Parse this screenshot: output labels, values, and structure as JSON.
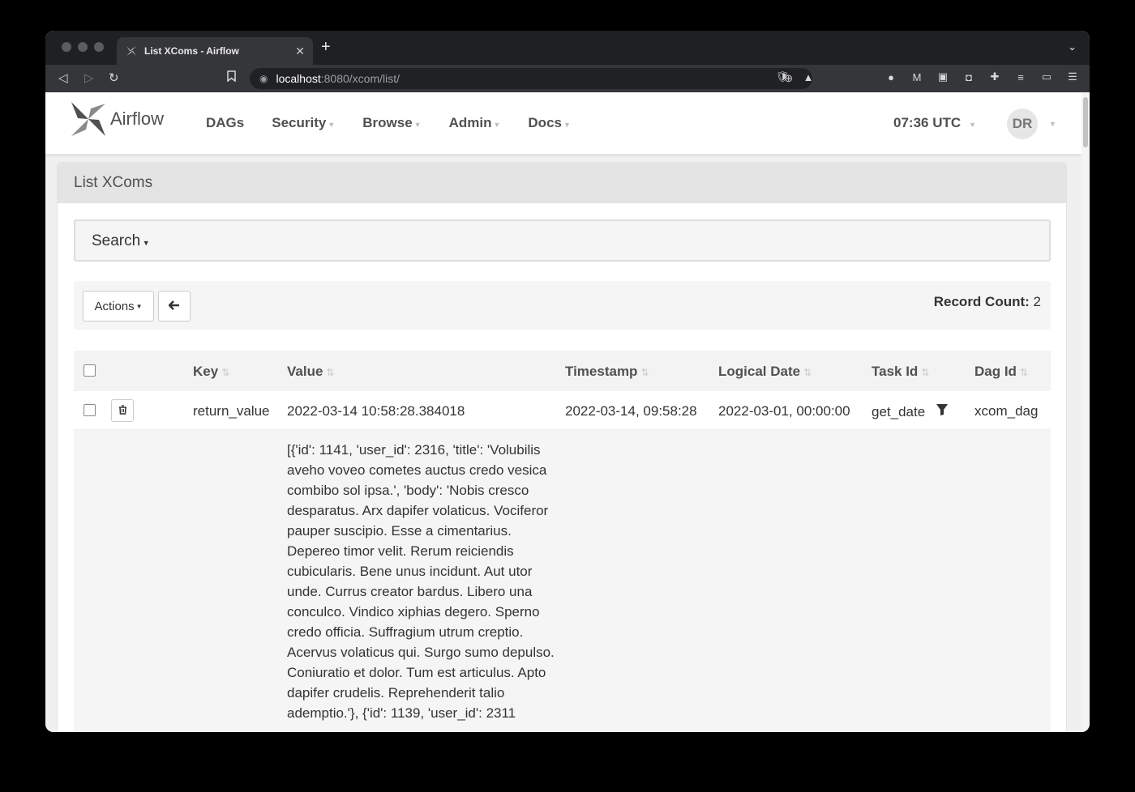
{
  "browser": {
    "tab_title": "List XComs - Airflow",
    "url_host": "localhost",
    "url_path": ":8080/xcom/list/"
  },
  "navbar": {
    "brand": "Airflow",
    "menu": [
      {
        "label": "DAGs"
      },
      {
        "label": "Security"
      },
      {
        "label": "Browse"
      },
      {
        "label": "Admin"
      },
      {
        "label": "Docs"
      }
    ],
    "clock": "07:36 UTC",
    "avatar_initials": "DR"
  },
  "panel": {
    "title": "List XComs",
    "search_label": "Search",
    "actions_label": "Actions",
    "record_count_label": "Record Count:",
    "record_count_value": "2"
  },
  "table": {
    "columns": [
      "Key",
      "Value",
      "Timestamp",
      "Logical Date",
      "Task Id",
      "Dag Id"
    ],
    "rows": [
      {
        "key": "return_value",
        "value": "2022-03-14 10:58:28.384018",
        "timestamp": "2022-03-14, 09:58:28",
        "logical_date": "2022-03-01, 00:00:00",
        "task_id": "get_date",
        "dag_id": "xcom_dag"
      },
      {
        "value": "[{'id': 1141, 'user_id': 2316, 'title': 'Volubilis aveho voveo cometes auctus credo vesica combibo sol ipsa.', 'body': 'Nobis cresco desparatus. Arx dapifer volaticus. Vociferor pauper suscipio. Esse a cimentarius. Depereo timor velit. Rerum reiciendis cubicularis. Bene unus incidunt. Aut utor unde. Currus creator bardus. Libero una conculco. Vindico xiphias degero. Sperno credo officia. Suffragium utrum creptio. Acervus volaticus qui. Surgo sumo depulso. Coniuratio et dolor. Tum est articulus. Apto dapifer crudelis. Reprehenderit talio ademptio.'}, {'id': 1139, 'user_id': 2311"
      }
    ]
  },
  "colors": {
    "tabstrip": "#1f2023",
    "toolbar": "#35363a",
    "nav_text": "#51504f",
    "panel_heading": "#e4e4e4"
  }
}
